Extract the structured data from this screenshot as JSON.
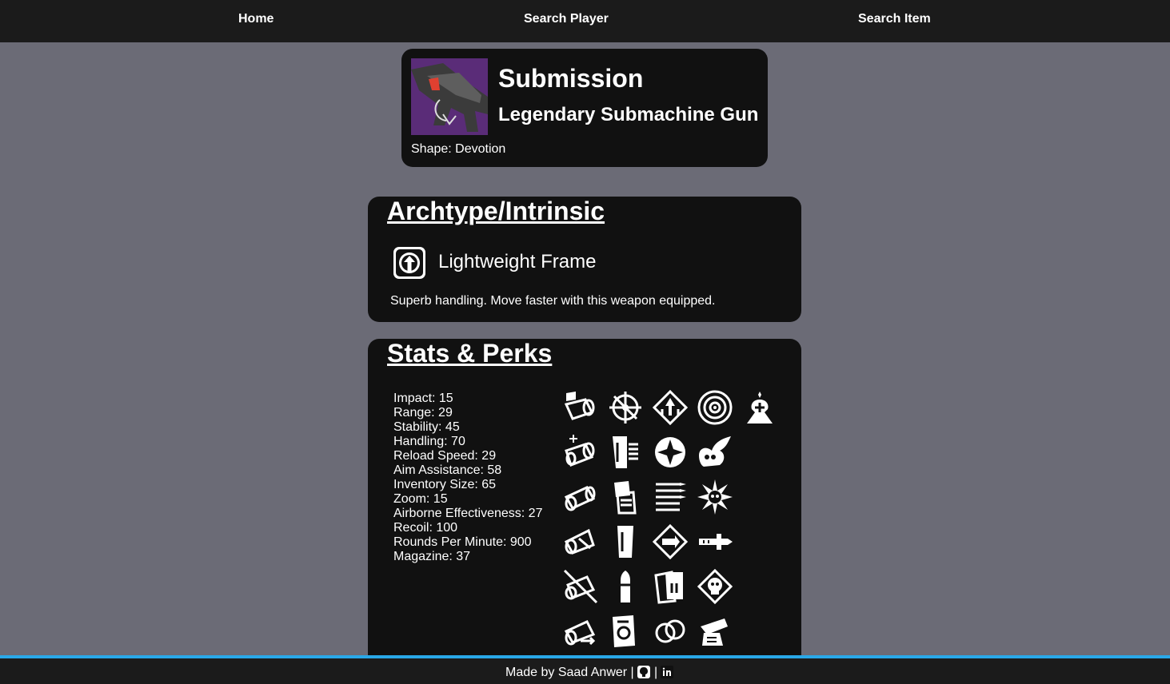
{
  "nav": {
    "home": "Home",
    "search_player": "Search Player",
    "search_item": "Search Item"
  },
  "item": {
    "name": "Submission",
    "type": "Legendary Submachine Gun",
    "shape": "Shape: Devotion",
    "thumb_color": "#5a2c78"
  },
  "archetype": {
    "title": "Archtype/Intrinsic",
    "name": "Lightweight Frame",
    "description": "Superb handling. Move faster with this weapon equipped.",
    "icon": "lightweight-frame-icon"
  },
  "stats_section": {
    "title": "Stats & Perks",
    "stats": [
      "Impact: 15",
      "Range: 29",
      "Stability: 45",
      "Handling: 70",
      "Reload Speed: 29",
      "Aim Assistance: 58",
      "Inventory Size: 65",
      "Zoom: 15",
      "Airborne Effectiveness: 27",
      "Recoil: 100",
      "Rounds Per Minute: 900",
      "Magazine: 37"
    ],
    "perk_columns": [
      [
        "barrel-perk-icon",
        "barrel-perk-icon",
        "barrel-perk-icon",
        "barrel-perk-icon",
        "barrel-perk-icon",
        "barrel-perk-icon"
      ],
      [
        "magazine-perk-icon",
        "magazine-perk-icon",
        "magazine-perk-icon",
        "magazine-perk-icon",
        "magazine-perk-icon",
        "magazine-perk-icon"
      ],
      [
        "trait-perk-icon",
        "trait-perk-icon",
        "trait-perk-icon",
        "trait-perk-icon",
        "trait-perk-icon",
        "trait-perk-icon"
      ],
      [
        "trait-perk-icon",
        "trait-perk-icon",
        "trait-perk-icon",
        "trait-perk-icon",
        "trait-perk-icon",
        "trait-perk-icon"
      ],
      [
        "origin-perk-icon"
      ]
    ]
  },
  "footer": {
    "text": "Made by Saad Anwer |",
    "separator": "|",
    "github_icon": "github-icon",
    "linkedin_icon": "linkedin-icon"
  },
  "colors": {
    "background": "#6b6b76",
    "card": "#111111",
    "navbar": "#1b1b1b",
    "footer_accent": "#29a8e8"
  }
}
